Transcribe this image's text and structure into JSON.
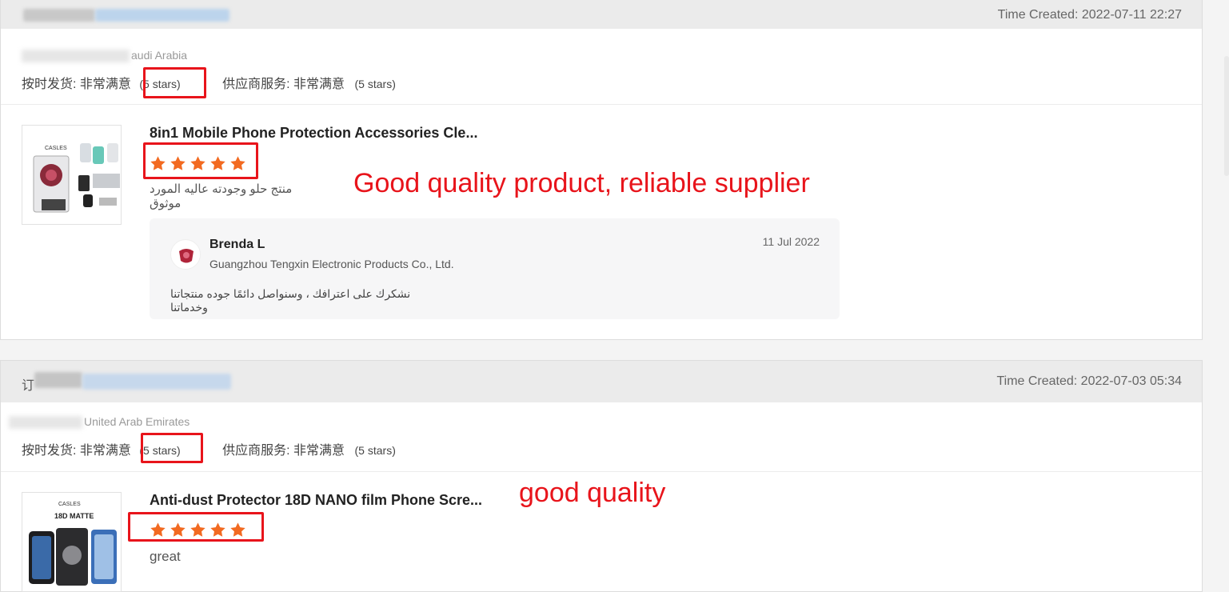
{
  "reviews": [
    {
      "time_created": "Time Created: 2022-07-11 22:27",
      "country_suffix": "audi Arabia",
      "delivery_label": "按时发货: 非常满意",
      "delivery_stars": "(5 stars)",
      "service_label": "供应商服务: 非常满意",
      "service_stars": "(5 stars)",
      "product_title": "8in1 Mobile Phone Protection Accessories Cle...",
      "rating": 5,
      "review_text": "منتج حلو وجودته عاليه المورد موثوق",
      "annotation": "Good quality product, reliable supplier",
      "reply": {
        "name": "Brenda L",
        "company": "Guangzhou Tengxin Electronic Products Co., Ltd.",
        "date": "11 Jul 2022",
        "text": "نشكرك على اعترافك ، وسنواصل دائمًا جوده منتجاتنا وخدماتنا"
      }
    },
    {
      "header_prefix": "订",
      "time_created": "Time Created: 2022-07-03 05:34",
      "country_suffix": "United Arab Emirates",
      "delivery_label": "按时发货: 非常满意",
      "delivery_stars": "(5 stars)",
      "service_label": "供应商服务: 非常满意",
      "service_stars": "(5 stars)",
      "product_title": "Anti-dust Protector 18D NANO film Phone Scre...",
      "rating": 5,
      "review_text": "great",
      "annotation": "good quality"
    }
  ],
  "thumbnails": {
    "first_brand": "CASLES",
    "second_brand": "CASLES",
    "second_caption": "18D MATTE"
  },
  "colors": {
    "star": "#f26a21",
    "annotation_red": "#e8141b",
    "header_bg": "#ebebeb"
  },
  "icons": {
    "star": "star-icon",
    "avatar": "bull-logo-icon"
  }
}
